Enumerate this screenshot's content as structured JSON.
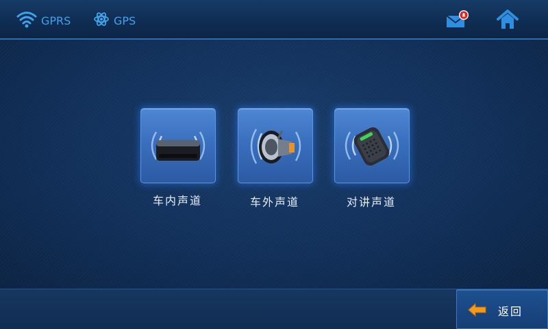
{
  "status_bar": {
    "gprs_label": "GPRS",
    "gps_label": "GPS",
    "accent_color": "#3fa3ea",
    "icons": [
      "wifi-icon",
      "atom-icon",
      "mail-notification-icon",
      "home-icon"
    ]
  },
  "channels": [
    {
      "label": "车内声道",
      "icon": "cabin-speaker-icon"
    },
    {
      "label": "车外声道",
      "icon": "loudspeaker-icon"
    },
    {
      "label": "对讲声道",
      "icon": "intercom-mic-icon"
    }
  ],
  "footer": {
    "back_label": "返回",
    "back_icon": "back-arrow-icon"
  }
}
